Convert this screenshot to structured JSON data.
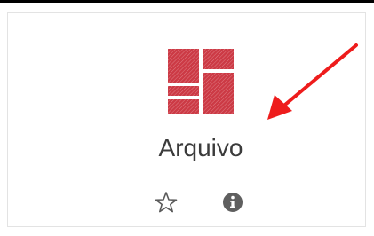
{
  "tile": {
    "icon": "grid-tile-icon",
    "title": "Arquivo",
    "icon_color": "#c9303b"
  },
  "actions": {
    "favorite_icon": "star-outline-icon",
    "info_icon": "info-circle-icon"
  },
  "annotation": {
    "arrow_icon": "red-arrow-icon",
    "arrow_color": "#ee1c1c"
  }
}
